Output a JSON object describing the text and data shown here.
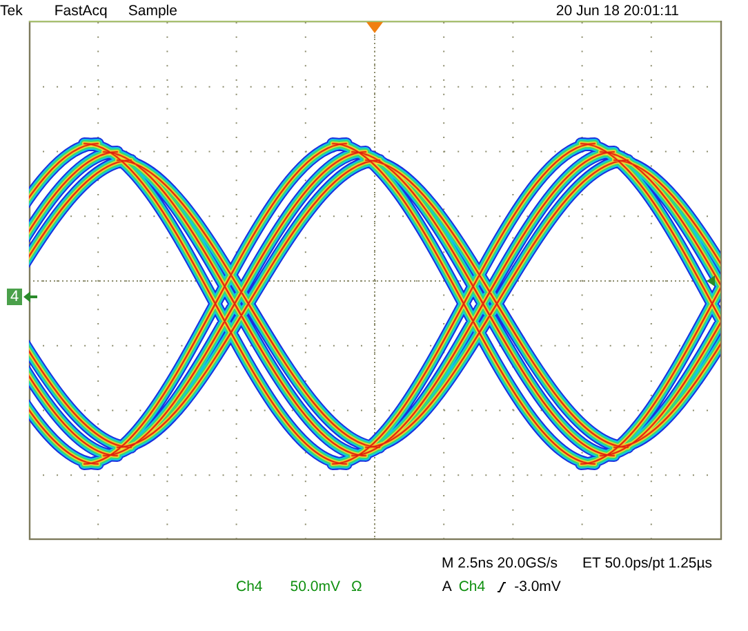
{
  "header": {
    "brand": "Tek",
    "mode": "FastAcq",
    "acquisition": "Sample",
    "timestamp": "20 Jun 18 20:01:11"
  },
  "channel_marker": "4",
  "horizontal": {
    "main": "M 2.5ns 20.0GS/s",
    "equivalent_time": "ET 50.0ps/pt 1.25µs"
  },
  "vertical": {
    "channel": "Ch4",
    "scale": "50.0mV",
    "coupling": "Ω"
  },
  "trigger": {
    "mode": "A",
    "channel": "Ch4",
    "level": "-3.0mV"
  }
}
